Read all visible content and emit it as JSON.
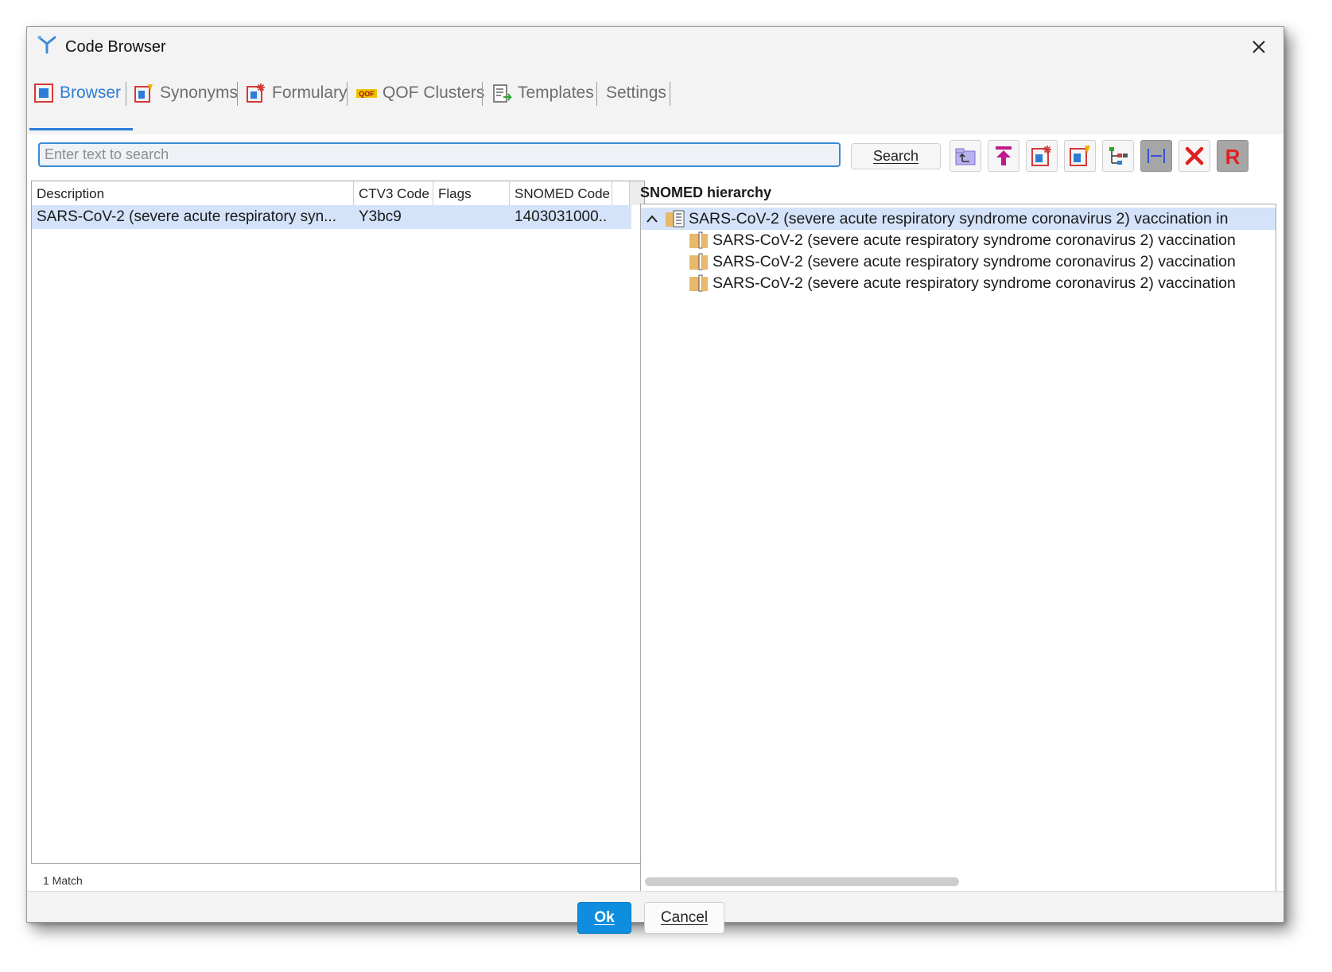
{
  "window": {
    "title": "Code Browser",
    "close_glyph": "✕",
    "icon": "code-browser-logo-icon"
  },
  "tabs": [
    {
      "label": "Browser",
      "icon": "browser-icon",
      "active": true
    },
    {
      "label": "Synonyms",
      "icon": "synonyms-icon",
      "active": false
    },
    {
      "label": "Formulary",
      "icon": "formulary-icon",
      "active": false
    },
    {
      "label": "QOF Clusters",
      "icon": "qof-icon",
      "icon_text": "QOF",
      "active": false
    },
    {
      "label": "Templates",
      "icon": "templates-icon",
      "active": false
    },
    {
      "label": "Settings",
      "active": false
    }
  ],
  "search": {
    "placeholder": "Enter text to search",
    "value": "",
    "button_label": "Search"
  },
  "toolbar": [
    {
      "name": "parent-level-icon"
    },
    {
      "name": "top-level-icon"
    },
    {
      "name": "add-formulary-icon"
    },
    {
      "name": "add-synonym-icon"
    },
    {
      "name": "hierarchy-tree-icon"
    },
    {
      "name": "fit-width-icon"
    },
    {
      "name": "clear-icon"
    },
    {
      "name": "read-code-icon",
      "label": "R"
    }
  ],
  "results": {
    "columns": [
      "Description",
      "CTV3 Code",
      "Flags",
      "SNOMED Code"
    ],
    "rows": [
      {
        "description": "SARS-CoV-2 (severe acute respiratory syn...",
        "ctv3": "Y3bc9",
        "flags": "",
        "snomed": "1403031000.."
      }
    ],
    "match_count": "1 Match"
  },
  "hierarchy": {
    "title": "SNOMED hierarchy",
    "nodes": [
      {
        "text": "SARS-CoV-2 (severe acute respiratory syndrome coronavirus 2) vaccination in",
        "level": 0,
        "expanded": true,
        "icon": "concept-book-icon"
      },
      {
        "text": "SARS-CoV-2 (severe acute respiratory syndrome coronavirus 2) vaccination",
        "level": 1,
        "icon": "concept-child-icon"
      },
      {
        "text": "SARS-CoV-2 (severe acute respiratory syndrome coronavirus 2) vaccination",
        "level": 1,
        "icon": "concept-child-icon"
      },
      {
        "text": "SARS-CoV-2 (severe acute respiratory syndrome coronavirus 2) vaccination",
        "level": 1,
        "icon": "concept-child-icon"
      }
    ]
  },
  "footer": {
    "ok_label": "Ok",
    "cancel_label": "Cancel"
  },
  "colors": {
    "accent": "#2c7dd6",
    "ok_button": "#0f8ee0",
    "selection": "#d4e3f9",
    "clear_red": "#e02020"
  }
}
